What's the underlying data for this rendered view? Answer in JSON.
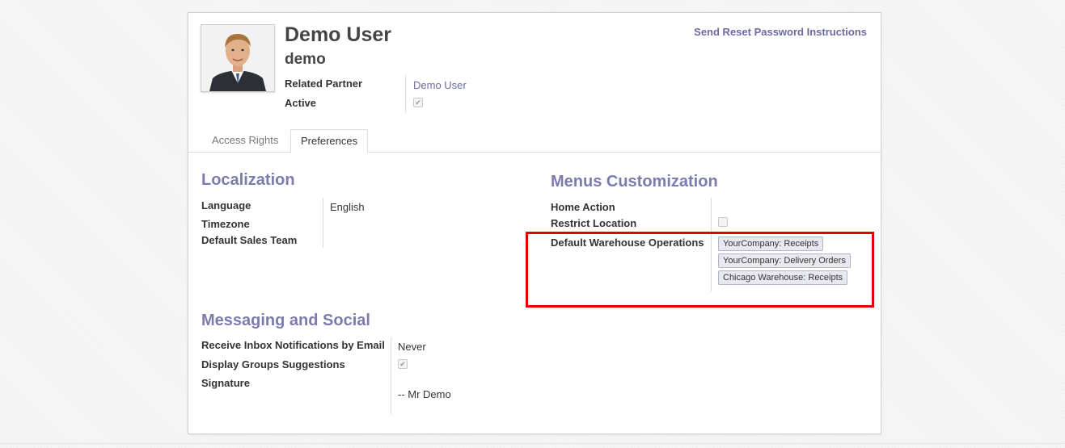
{
  "user": {
    "name": "Demo User",
    "login": "demo",
    "related_partner_label": "Related Partner",
    "related_partner_value": "Demo User",
    "active_label": "Active",
    "active": true
  },
  "actions": {
    "reset_password": "Send Reset Password Instructions"
  },
  "tabs": [
    {
      "label": "Access Rights",
      "active": false
    },
    {
      "label": "Preferences",
      "active": true
    }
  ],
  "localization": {
    "title": "Localization",
    "language_label": "Language",
    "language_value": "English",
    "timezone_label": "Timezone",
    "sales_team_label": "Default Sales Team"
  },
  "menus": {
    "title": "Menus Customization",
    "home_action_label": "Home Action",
    "restrict_location_label": "Restrict Location",
    "restrict_location": false,
    "warehouse_ops_label": "Default Warehouse Operations",
    "warehouse_ops": [
      "YourCompany: Receipts",
      "YourCompany: Delivery Orders",
      "Chicago Warehouse: Receipts"
    ]
  },
  "messaging": {
    "title": "Messaging and Social",
    "inbox_label": "Receive Inbox Notifications by Email",
    "inbox_value": "Never",
    "groups_label": "Display Groups Suggestions",
    "groups_suggestions": true,
    "signature_label": "Signature",
    "signature_value": "-- Mr Demo"
  },
  "colors": {
    "accent": "#7c7bad",
    "link": "#6c6aa3",
    "highlight": "#e00000"
  }
}
